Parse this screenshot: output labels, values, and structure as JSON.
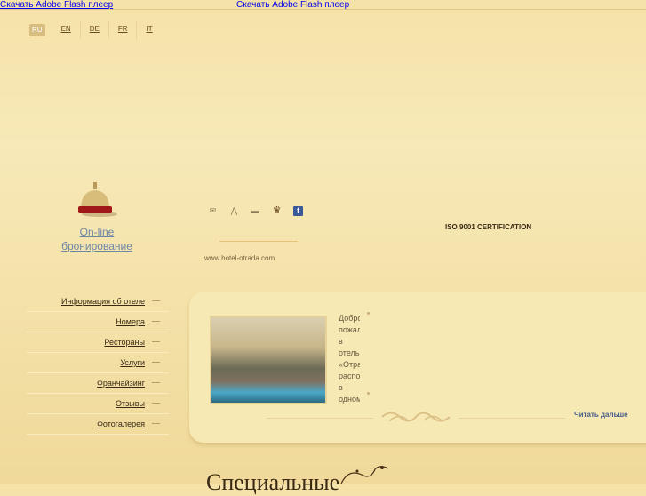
{
  "top": {
    "flash_link_1": "Скачать Adobe Flash плеер",
    "flash_link_2": "Скачать Adobe Flash плеер"
  },
  "languages": [
    {
      "code": "RU",
      "active": true
    },
    {
      "code": "EN"
    },
    {
      "code": "DE"
    },
    {
      "code": "FR"
    },
    {
      "code": "IT"
    }
  ],
  "booking": {
    "line1": "On-line",
    "line2": "бронирование"
  },
  "social_icons": [
    "mail-icon",
    "sitemap-icon",
    "print-icon",
    "crown-icon",
    "facebook-icon"
  ],
  "facebook_glyph": "f",
  "certification": "ISO 9001 CERTIFICATION",
  "website": "www.hotel-otrada.com",
  "menu": [
    "Информация об отеле",
    "Номера",
    "Рестораны",
    "Услуги",
    "Франчайзинг",
    "Отзывы",
    "Фотогалерея"
  ],
  "intro": {
    "lines": [
      "Добро",
      "пожаловать",
      "в",
      "отель",
      "«Отрада»",
      "расположен",
      "в",
      "одном"
    ],
    "read_more": "Читать дальше"
  },
  "section_heading": "Специальные"
}
